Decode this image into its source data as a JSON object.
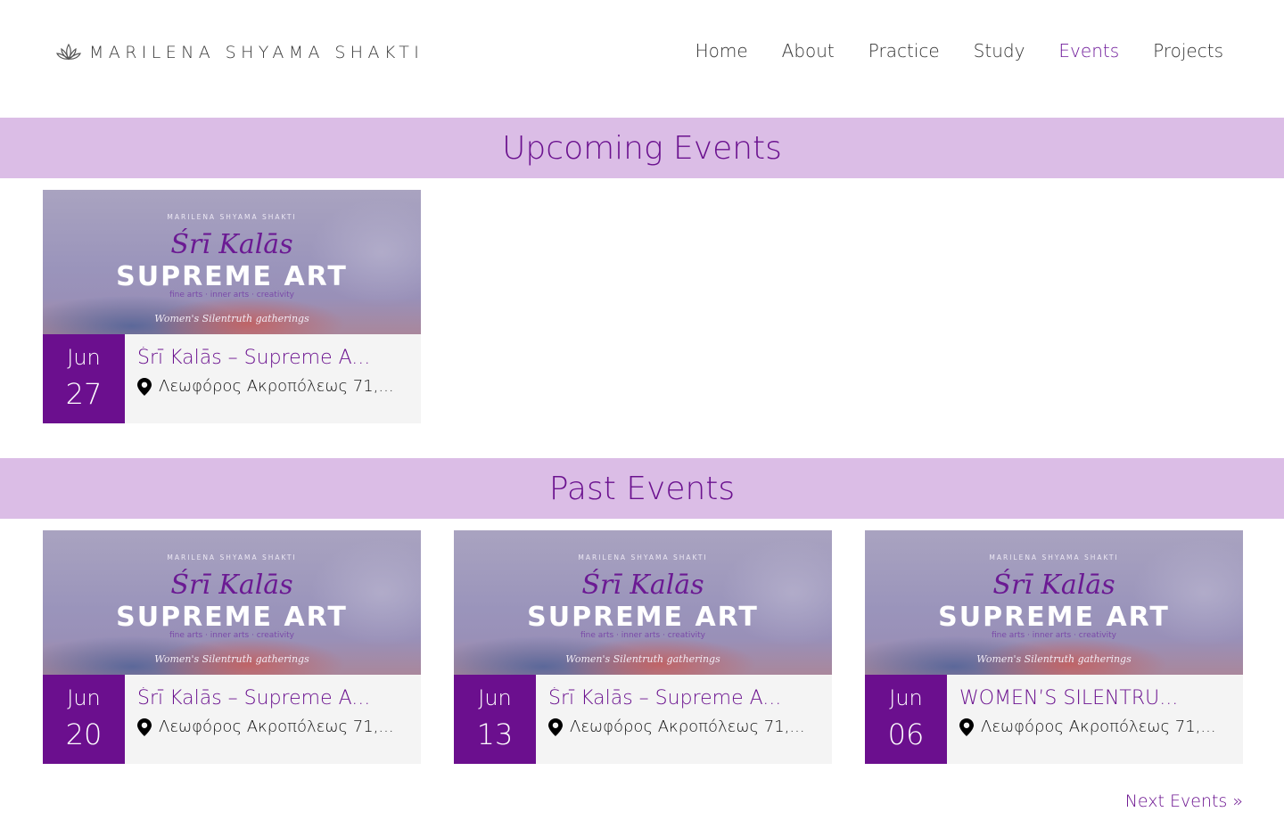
{
  "brand": {
    "name": "MARILENA SHYAMA SHAKTI",
    "icon": "lotus-icon"
  },
  "nav": {
    "items": [
      {
        "label": "Home",
        "active": false
      },
      {
        "label": "About",
        "active": false
      },
      {
        "label": "Practice",
        "active": false
      },
      {
        "label": "Study",
        "active": false
      },
      {
        "label": "Events",
        "active": true
      },
      {
        "label": "Projects",
        "active": false
      }
    ]
  },
  "colors": {
    "accent": "#6b128f",
    "band": "#dbbde6",
    "date_bg": "#6b0f8e",
    "card_bg": "#f4f4f4"
  },
  "upcoming": {
    "title": "Upcoming Events",
    "events": [
      {
        "month": "Jun",
        "day": "27",
        "title": "Śrī Kalās – Supreme A...",
        "location": "Λεωφόρος Ακροπόλεως 71,...",
        "image": {
          "brand": "MARILENA SHYAMA SHAKTI",
          "script": "Śrī Kalās",
          "headline": "SUPREME ART",
          "subtitle": "fine arts · inner arts · creativity",
          "tagline": "Women's Silentruth gatherings"
        }
      }
    ]
  },
  "past": {
    "title": "Past Events",
    "events": [
      {
        "month": "Jun",
        "day": "20",
        "title": "Śrī Kalās – Supreme A...",
        "location": "Λεωφόρος Ακροπόλεως 71,...",
        "image": {
          "brand": "MARILENA SHYAMA SHAKTI",
          "script": "Śrī Kalās",
          "headline": "SUPREME ART",
          "subtitle": "fine arts · inner arts · creativity",
          "tagline": "Women's Silentruth gatherings"
        }
      },
      {
        "month": "Jun",
        "day": "13",
        "title": "Śrī Kalās – Supreme A...",
        "location": "Λεωφόρος Ακροπόλεως 71,...",
        "image": {
          "brand": "MARILENA SHYAMA SHAKTI",
          "script": "Śrī Kalās",
          "headline": "SUPREME ART",
          "subtitle": "fine arts · inner arts · creativity",
          "tagline": "Women's Silentruth gatherings"
        }
      },
      {
        "month": "Jun",
        "day": "06",
        "title": "WOMEN’S SILENTRU...",
        "location": "Λεωφόρος Ακροπόλεως 71,...",
        "image": {
          "brand": "MARILENA SHYAMA SHAKTI",
          "script": "Śrī Kalās",
          "headline": "SUPREME ART",
          "subtitle": "fine arts · inner arts · creativity",
          "tagline": "Women's Silentruth gatherings"
        }
      }
    ]
  },
  "pagination": {
    "next_label": "Next Events »"
  }
}
